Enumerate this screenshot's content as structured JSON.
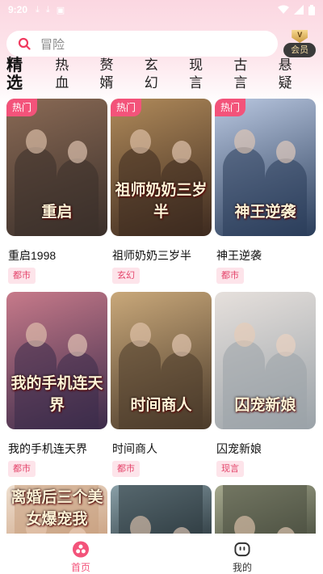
{
  "status_bar": {
    "time": "9:20",
    "icons": [
      "download-icon",
      "download-icon",
      "font-icon"
    ],
    "right_icons": [
      "wifi-icon",
      "signal-icon",
      "battery-icon"
    ]
  },
  "search": {
    "placeholder": "冒险"
  },
  "vip": {
    "badge": "V",
    "label": "会员"
  },
  "tabs": [
    "精选",
    "热血",
    "赘婿",
    "玄幻",
    "现言",
    "古言",
    "悬疑"
  ],
  "active_tab": 0,
  "hot_label": "热门",
  "cards": [
    {
      "title": "重启1998",
      "genre": "都市",
      "hot": true,
      "poster_text": "重启",
      "colors": [
        "#3a2f2a",
        "#8a6a55"
      ]
    },
    {
      "title": "祖师奶奶三岁半",
      "genre": "玄幻",
      "hot": true,
      "poster_text": "祖师奶奶三岁半",
      "colors": [
        "#3d2a1f",
        "#b08a5a"
      ]
    },
    {
      "title": "神王逆袭",
      "genre": "都市",
      "hot": true,
      "poster_text": "神王逆袭",
      "colors": [
        "#2a3d5a",
        "#b9c7e0"
      ]
    },
    {
      "title": "我的手机连天界",
      "genre": "都市",
      "hot": false,
      "poster_text": "我的手机连天界",
      "colors": [
        "#3b2b4a",
        "#c77a8a"
      ]
    },
    {
      "title": "时间商人",
      "genre": "都市",
      "hot": false,
      "poster_text": "时间商人",
      "colors": [
        "#4a3a2a",
        "#c9a87a"
      ]
    },
    {
      "title": "囚宠新娘",
      "genre": "现言",
      "hot": false,
      "poster_text": "囚宠新娘",
      "colors": [
        "#9aa2a8",
        "#e6e0dc"
      ]
    }
  ],
  "partial_cards": [
    {
      "poster_text": "离婚后三个美女爆宠我",
      "colors": [
        "#c9a080",
        "#f0e0d0"
      ]
    },
    {
      "poster_text": "",
      "colors": [
        "#2d3a40",
        "#8aa0a8"
      ]
    },
    {
      "poster_text": "",
      "colors": [
        "#4a4f40",
        "#a6a98e"
      ]
    }
  ],
  "bottom_nav": [
    {
      "label": "首页",
      "icon": "home-icon",
      "active": true
    },
    {
      "label": "我的",
      "icon": "profile-icon",
      "active": false
    }
  ],
  "accent_color": "#f3537a"
}
